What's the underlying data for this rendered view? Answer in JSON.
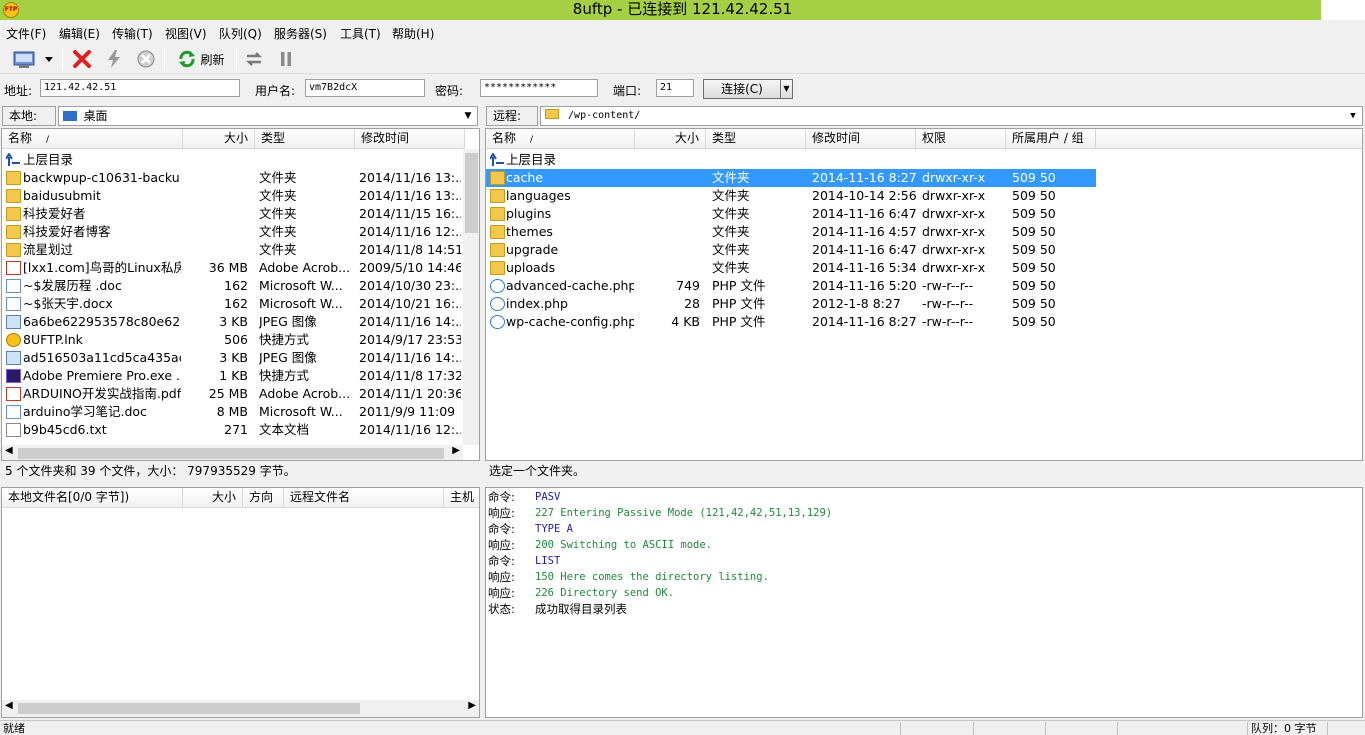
{
  "window": {
    "title": "8uftp - 已连接到 121.42.42.51",
    "app_icon_text": "FTP"
  },
  "menu": [
    "文件(F)",
    "编辑(E)",
    "传输(T)",
    "视图(V)",
    "队列(Q)",
    "服务器(S)",
    "工具(T)",
    "帮助(H)"
  ],
  "toolbar": {
    "refresh_label": "刷新"
  },
  "connection": {
    "address_label": "地址:",
    "address_value": "121.42.42.51",
    "user_label": "用户名:",
    "user_value": "vm7B2dcX",
    "password_label": "密码:",
    "password_value": "************",
    "port_label": "端口:",
    "port_value": "21",
    "connect_label": "连接(C)"
  },
  "local": {
    "path_label": "本地:",
    "path_value": "桌面",
    "columns": [
      "名称",
      "大小",
      "类型",
      "修改时间"
    ],
    "sort_indicator": "/",
    "up_label": "上层目录",
    "files": [
      {
        "name": "backwpup-c10631-backu...",
        "size": "",
        "type": "文件夹",
        "date": "2014/11/16 13:...",
        "icon": "folder"
      },
      {
        "name": "baidusubmit",
        "size": "",
        "type": "文件夹",
        "date": "2014/11/16 13:...",
        "icon": "folder"
      },
      {
        "name": "科技爱好者",
        "size": "",
        "type": "文件夹",
        "date": "2014/11/15 16:...",
        "icon": "folder"
      },
      {
        "name": "科技爱好者博客",
        "size": "",
        "type": "文件夹",
        "date": "2014/11/16 12:...",
        "icon": "folder"
      },
      {
        "name": "流星划过",
        "size": "",
        "type": "文件夹",
        "date": "2014/11/8 14:51",
        "icon": "folder"
      },
      {
        "name": "[lxx1.com]鸟哥的Linux私房...",
        "size": "36 MB",
        "type": "Adobe Acrob...",
        "date": "2009/5/10 14:46",
        "icon": "pdf"
      },
      {
        "name": "~$发展历程 .doc",
        "size": "162",
        "type": "Microsoft W...",
        "date": "2014/10/30 23:...",
        "icon": "doc"
      },
      {
        "name": "~$张天宇.docx",
        "size": "162",
        "type": "Microsoft W...",
        "date": "2014/10/21 16:...",
        "icon": "doc"
      },
      {
        "name": "6a6be622953578c80e62a...",
        "size": "3 KB",
        "type": "JPEG 图像",
        "date": "2014/11/16 14:...",
        "icon": "img"
      },
      {
        "name": "8UFTP.lnk",
        "size": "506",
        "type": "快捷方式",
        "date": "2014/9/17 23:53",
        "icon": "lnk"
      },
      {
        "name": "ad516503a11cd5ca435ac...",
        "size": "3 KB",
        "type": "JPEG 图像",
        "date": "2014/11/16 14:...",
        "icon": "img"
      },
      {
        "name": "Adobe Premiere Pro.exe ...",
        "size": "1 KB",
        "type": "快捷方式",
        "date": "2014/11/8 17:32",
        "icon": "pr"
      },
      {
        "name": "ARDUINO开发实战指南.pdf",
        "size": "25 MB",
        "type": "Adobe Acrob...",
        "date": "2014/11/1 20:36",
        "icon": "pdf"
      },
      {
        "name": "arduino学习笔记.doc",
        "size": "8 MB",
        "type": "Microsoft W...",
        "date": "2011/9/9 11:09",
        "icon": "doc"
      },
      {
        "name": "b9b45cd6.txt",
        "size": "271",
        "type": "文本文档",
        "date": "2014/11/16 12:...",
        "icon": "txt"
      }
    ],
    "status": "5 个文件夹和 39 个文件，大小： 797935529 字节。"
  },
  "remote": {
    "path_label": "远程:",
    "path_value": "/wp-content/",
    "columns": [
      "名称",
      "大小",
      "类型",
      "修改时间",
      "权限",
      "所属用户 / 组"
    ],
    "sort_indicator": "/",
    "up_label": "上层目录",
    "files": [
      {
        "name": "cache",
        "size": "",
        "type": "文件夹",
        "date": "2014-11-16 8:27",
        "perm": "drwxr-xr-x",
        "owner": "509 50",
        "icon": "folder",
        "selected": true
      },
      {
        "name": "languages",
        "size": "",
        "type": "文件夹",
        "date": "2014-10-14 2:56",
        "perm": "drwxr-xr-x",
        "owner": "509 50",
        "icon": "folder"
      },
      {
        "name": "plugins",
        "size": "",
        "type": "文件夹",
        "date": "2014-11-16 6:47",
        "perm": "drwxr-xr-x",
        "owner": "509 50",
        "icon": "folder"
      },
      {
        "name": "themes",
        "size": "",
        "type": "文件夹",
        "date": "2014-11-16 4:57",
        "perm": "drwxr-xr-x",
        "owner": "509 50",
        "icon": "folder"
      },
      {
        "name": "upgrade",
        "size": "",
        "type": "文件夹",
        "date": "2014-11-16 6:47",
        "perm": "drwxr-xr-x",
        "owner": "509 50",
        "icon": "folder"
      },
      {
        "name": "uploads",
        "size": "",
        "type": "文件夹",
        "date": "2014-11-16 5:34",
        "perm": "drwxr-xr-x",
        "owner": "509 50",
        "icon": "folder"
      },
      {
        "name": "advanced-cache.php",
        "size": "749",
        "type": "PHP 文件",
        "date": "2014-11-16 5:20",
        "perm": "-rw-r--r--",
        "owner": "509 50",
        "icon": "php"
      },
      {
        "name": "index.php",
        "size": "28",
        "type": "PHP 文件",
        "date": "2012-1-8 8:27",
        "perm": "-rw-r--r--",
        "owner": "509 50",
        "icon": "php"
      },
      {
        "name": "wp-cache-config.php",
        "size": "4 KB",
        "type": "PHP 文件",
        "date": "2014-11-16 8:27",
        "perm": "-rw-r--r--",
        "owner": "509 50",
        "icon": "php"
      }
    ],
    "status": "选定一个文件夹。"
  },
  "queue": {
    "columns": [
      "本地文件名[0/0 字节])",
      "大小",
      "方向",
      "远程文件名",
      "主机"
    ]
  },
  "log": [
    {
      "key": "命令:",
      "value": "PASV",
      "kind": "cmd"
    },
    {
      "key": "响应:",
      "value": "227 Entering Passive Mode (121,42,42,51,13,129)",
      "kind": "resp"
    },
    {
      "key": "命令:",
      "value": "TYPE A",
      "kind": "cmd"
    },
    {
      "key": "响应:",
      "value": "200 Switching to ASCII mode.",
      "kind": "resp"
    },
    {
      "key": "命令:",
      "value": "LIST",
      "kind": "cmd"
    },
    {
      "key": "响应:",
      "value": "150 Here comes the directory listing.",
      "kind": "resp"
    },
    {
      "key": "响应:",
      "value": "226 Directory send OK.",
      "kind": "resp"
    },
    {
      "key": "状态:",
      "value": "成功取得目录列表",
      "kind": "status"
    }
  ],
  "colors": {
    "cmd": "#1d1dba",
    "resp": "#1f8a3a",
    "status": "#000000",
    "selection": "#3399ff",
    "titlebar": "#a6d043"
  },
  "statusbar": {
    "left": "就绪",
    "queue": "队列：0 字节"
  }
}
